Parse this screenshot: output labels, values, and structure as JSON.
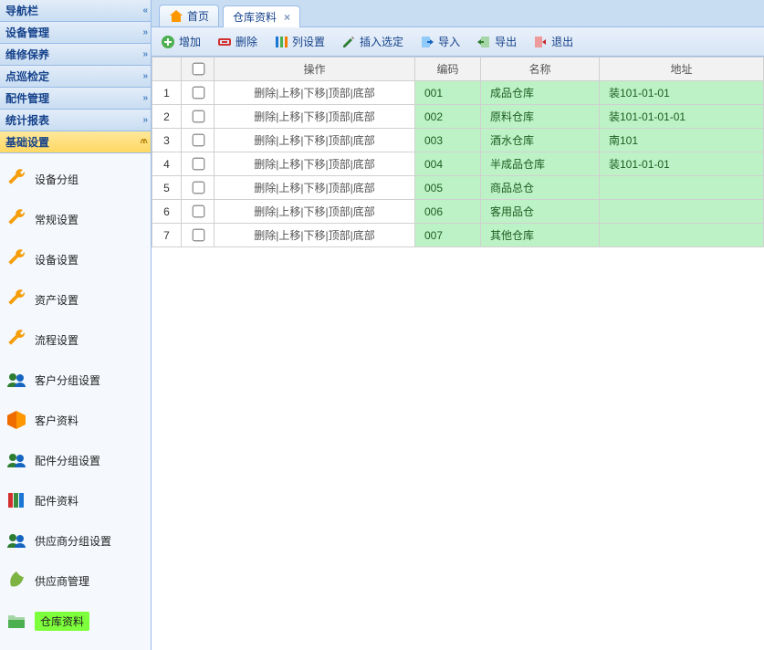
{
  "sidebar": {
    "title": "导航栏",
    "groups": [
      {
        "label": "设备管理"
      },
      {
        "label": "维修保养"
      },
      {
        "label": "点巡检定"
      },
      {
        "label": "配件管理"
      },
      {
        "label": "统计报表"
      },
      {
        "label": "基础设置",
        "active": true
      }
    ],
    "items": [
      {
        "label": "设备分组",
        "icon": "wrench"
      },
      {
        "label": "常规设置",
        "icon": "wrench"
      },
      {
        "label": "设备设置",
        "icon": "wrench"
      },
      {
        "label": "资产设置",
        "icon": "wrench"
      },
      {
        "label": "流程设置",
        "icon": "wrench"
      },
      {
        "label": "客户分组设置",
        "icon": "group"
      },
      {
        "label": "客户资料",
        "icon": "box"
      },
      {
        "label": "配件分组设置",
        "icon": "group"
      },
      {
        "label": "配件资料",
        "icon": "books"
      },
      {
        "label": "供应商分组设置",
        "icon": "group"
      },
      {
        "label": "供应商管理",
        "icon": "leaf"
      },
      {
        "label": "仓库资料",
        "icon": "folder",
        "selected": true
      }
    ]
  },
  "tabs": [
    {
      "label": "首页",
      "icon": "home",
      "closable": false
    },
    {
      "label": "仓库资料",
      "active": true,
      "closable": true
    }
  ],
  "toolbar": [
    {
      "key": "add",
      "label": "增加"
    },
    {
      "key": "delete",
      "label": "删除"
    },
    {
      "key": "columns",
      "label": "列设置"
    },
    {
      "key": "insert",
      "label": "插入选定"
    },
    {
      "key": "import",
      "label": "导入"
    },
    {
      "key": "export",
      "label": "导出"
    },
    {
      "key": "exit",
      "label": "退出"
    }
  ],
  "grid": {
    "headers": {
      "ops": "操作",
      "code": "编码",
      "name": "名称",
      "addr": "地址"
    },
    "row_ops_text": "删除|上移|下移|顶部|底部",
    "rows": [
      {
        "code": "001",
        "name": "成品仓库",
        "addr": "装101-01-01"
      },
      {
        "code": "002",
        "name": "原料仓库",
        "addr": "装101-01-01-01"
      },
      {
        "code": "003",
        "name": "酒水仓库",
        "addr": "南101"
      },
      {
        "code": "004",
        "name": "半成品仓库",
        "addr": "装101-01-01"
      },
      {
        "code": "005",
        "name": "商品总仓",
        "addr": ""
      },
      {
        "code": "006",
        "name": "客用品仓",
        "addr": ""
      },
      {
        "code": "007",
        "name": "其他仓库",
        "addr": ""
      }
    ]
  }
}
